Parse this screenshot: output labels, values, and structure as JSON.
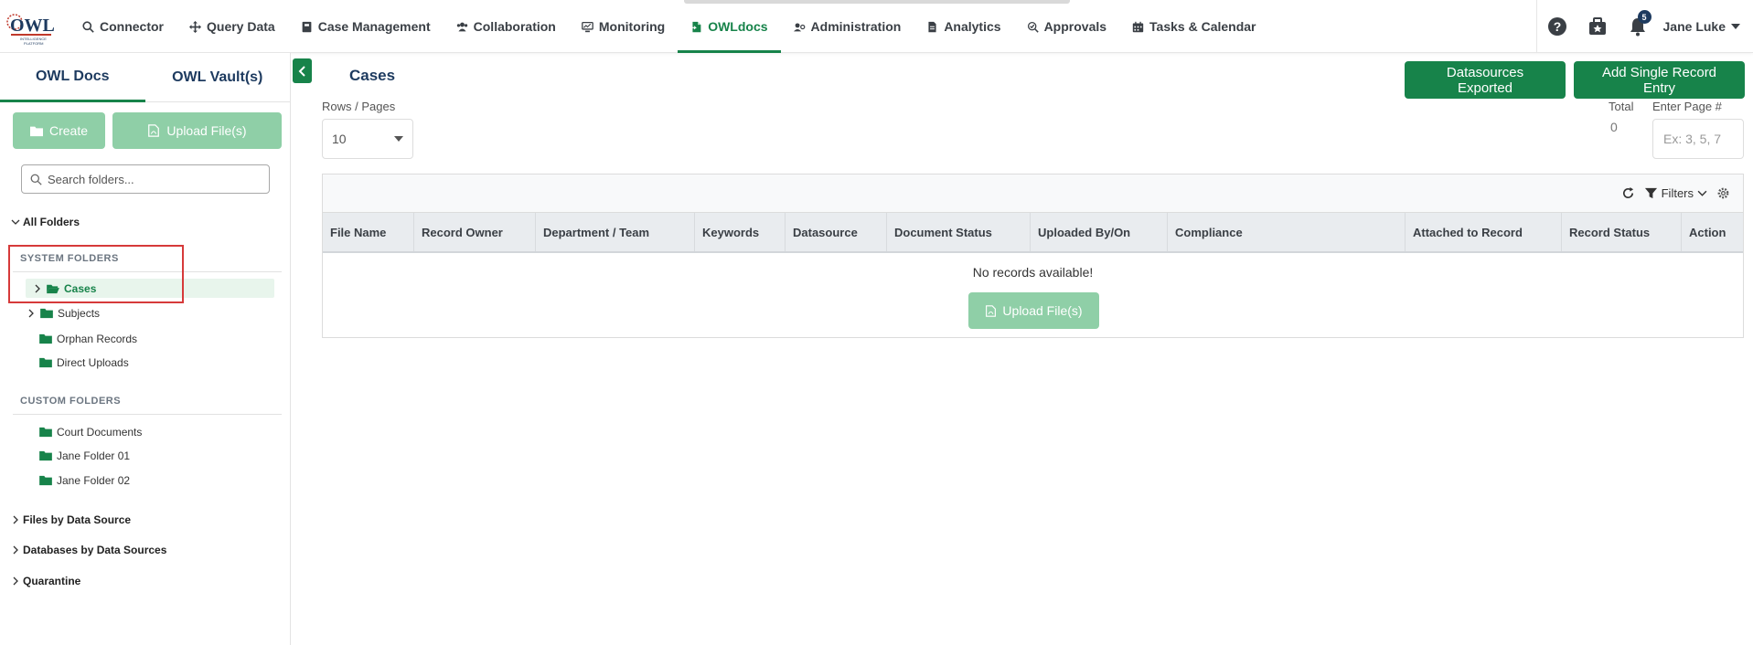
{
  "nav": {
    "items": [
      {
        "label": "Connector",
        "icon": "search-icon"
      },
      {
        "label": "Query Data",
        "icon": "move-icon"
      },
      {
        "label": "Case Management",
        "icon": "case-icon"
      },
      {
        "label": "Collaboration",
        "icon": "users-icon"
      },
      {
        "label": "Monitoring",
        "icon": "monitor-icon"
      },
      {
        "label": "OWLdocs",
        "icon": "doc-icon"
      },
      {
        "label": "Administration",
        "icon": "admin-icon"
      },
      {
        "label": "Analytics",
        "icon": "file-icon"
      },
      {
        "label": "Approvals",
        "icon": "approval-icon"
      },
      {
        "label": "Tasks & Calendar",
        "icon": "calendar-icon"
      }
    ],
    "active": "OWLdocs",
    "notification_count": "5",
    "user_name": "Jane Luke"
  },
  "sidebar": {
    "tabs": [
      "OWL Docs",
      "OWL Vault(s)"
    ],
    "create_label": "Create",
    "upload_label": "Upload File(s)",
    "search_placeholder": "Search folders...",
    "all_folders": "All Folders",
    "system_label": "SYSTEM FOLDERS",
    "system_folders": [
      "Cases",
      "Subjects",
      "Orphan Records",
      "Direct Uploads"
    ],
    "custom_label": "CUSTOM FOLDERS",
    "custom_folders": [
      "Court Documents",
      "Jane Folder 01",
      "Jane Folder 02"
    ],
    "roots": [
      "Files by Data Source",
      "Databases by Data Sources",
      "Quarantine"
    ]
  },
  "main": {
    "title": "Cases",
    "exported_label": "Datasources Exported",
    "add_label": "Add Single Record Entry",
    "rows_label": "Rows / Pages",
    "rows_value": "10",
    "total_label": "Total",
    "total_value": "0",
    "page_label": "Enter Page #",
    "page_placeholder": "Ex: 3, 5, 7",
    "filters_label": "Filters",
    "columns": [
      "File Name",
      "Record Owner",
      "Department / Team",
      "Keywords",
      "Datasource",
      "Document Status",
      "Uploaded By/On",
      "Compliance",
      "Attached to Record",
      "Record Status",
      "Action"
    ],
    "empty_message": "No records available!",
    "upload_label": "Upload File(s)"
  },
  "colors": {
    "brand_green": "#17834a",
    "light_green": "#8fcfa7",
    "navy": "#1d3a5f",
    "highlight_red": "#d63a3a"
  }
}
